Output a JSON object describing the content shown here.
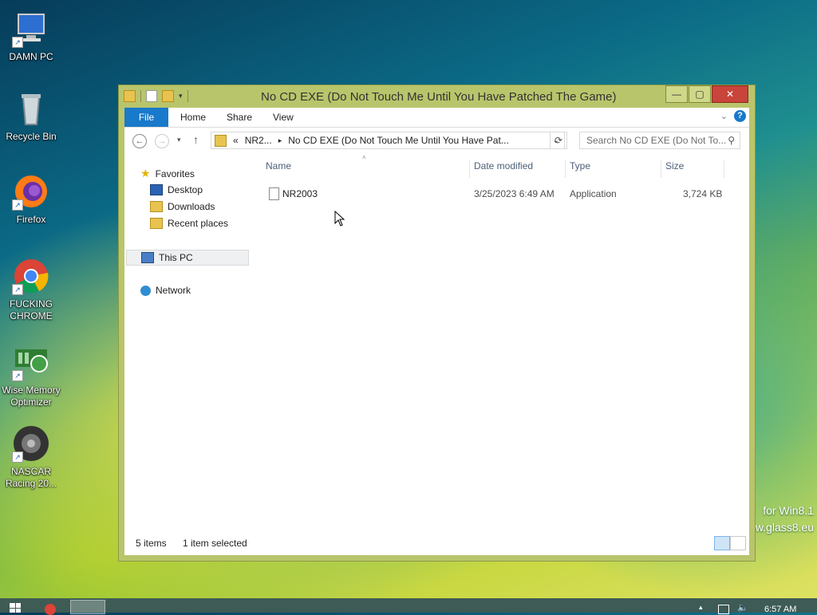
{
  "desktop": {
    "icons": [
      {
        "label": "DAMN PC"
      },
      {
        "label": "Recycle Bin"
      },
      {
        "label": "Firefox"
      },
      {
        "label": "FUCKING CHROME"
      },
      {
        "label": "Wise Memory Optimizer"
      },
      {
        "label": "NASCAR Racing 20..."
      }
    ],
    "watermark_line1": "for Win8.1",
    "watermark_line2": "w.glass8.eu"
  },
  "window": {
    "title": "No CD EXE (Do Not Touch Me Until You Have Patched The Game)",
    "controls": {
      "minimize": "—",
      "maximize": "▢",
      "close": "✕"
    },
    "ribbon_tabs": {
      "file": "File",
      "home": "Home",
      "share": "Share",
      "view": "View"
    },
    "help_glyph": "?",
    "address": {
      "overflow": "«",
      "crumb1": "NR2...",
      "crumb2": "No CD EXE (Do Not Touch Me Until You Have Pat..."
    },
    "search_placeholder": "Search No CD EXE (Do Not To...",
    "nav": {
      "favorites": "Favorites",
      "desktop": "Desktop",
      "downloads": "Downloads",
      "recent": "Recent places",
      "this_pc": "This PC",
      "network": "Network"
    },
    "columns": {
      "name": "Name",
      "date": "Date modified",
      "type": "Type",
      "size": "Size"
    },
    "files": [
      {
        "name": "NR2003",
        "date": "3/25/2023 6:49 AM",
        "type": "Application",
        "size": "3,724 KB"
      }
    ],
    "status": {
      "items": "5 items",
      "selected": "1 item selected"
    }
  },
  "taskbar": {
    "time": "6:57 AM"
  },
  "colors": {
    "file_tab": "#1979ca",
    "window_frame": "#b9c56b",
    "close_button": "#c9443a"
  }
}
